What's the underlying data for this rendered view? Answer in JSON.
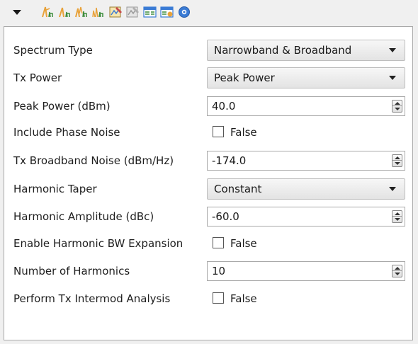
{
  "toolbar": {
    "icons": [
      "collapse-arrow-icon",
      "harmonic-peak-icon",
      "harmonic-pair-icon",
      "harmonic-multi-icon",
      "harmonic-spread-icon",
      "plot-edit-icon",
      "plot-disabled-icon",
      "table-view-icon",
      "table-export-icon",
      "help-icon"
    ]
  },
  "properties": [
    {
      "label": "Spectrum Type",
      "control": "select",
      "value": "Narrowband & Broadband"
    },
    {
      "label": "Tx Power",
      "control": "select",
      "value": "Peak Power"
    },
    {
      "label": "Peak Power (dBm)",
      "control": "spin",
      "value": "40.0"
    },
    {
      "label": "Include Phase Noise",
      "control": "check",
      "value": "False"
    },
    {
      "label": "Tx Broadband Noise (dBm/Hz)",
      "control": "spin",
      "value": "-174.0"
    },
    {
      "label": "Harmonic Taper",
      "control": "select",
      "value": "Constant"
    },
    {
      "label": "Harmonic Amplitude (dBc)",
      "control": "spin",
      "value": "-60.0"
    },
    {
      "label": "Enable Harmonic BW Expansion",
      "control": "check",
      "value": "False"
    },
    {
      "label": "Number of Harmonics",
      "control": "spin",
      "value": "10"
    },
    {
      "label": "Perform Tx Intermod Analysis",
      "control": "check",
      "value": "False"
    }
  ],
  "colors": {
    "panel_bg": "#ffffff",
    "window_bg": "#f0f0f0",
    "icon_orange": "#e8a23a",
    "icon_green": "#3c8c3c",
    "icon_blue": "#3a7bd5"
  }
}
